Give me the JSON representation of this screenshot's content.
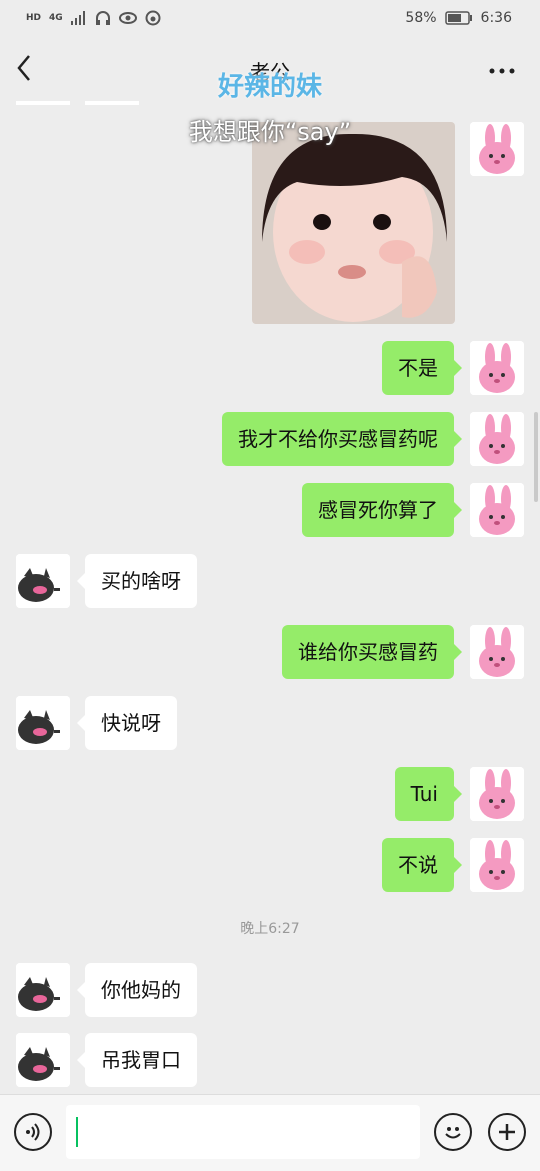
{
  "status_bar": {
    "network": "4G",
    "battery": "58%",
    "time": "6:36"
  },
  "header": {
    "title": "老公"
  },
  "sticker": {
    "caption_top": "好辣的妹",
    "caption_bottom": "我想跟你“say”"
  },
  "messages": [
    {
      "from": "me",
      "text": "不是"
    },
    {
      "from": "me",
      "text": "我才不给你买感冒药呢"
    },
    {
      "from": "me",
      "text": "感冒死你算了"
    },
    {
      "from": "them",
      "text": "买的啥呀"
    },
    {
      "from": "me",
      "text": "谁给你买感冒药"
    },
    {
      "from": "them",
      "text": "快说呀"
    },
    {
      "from": "me",
      "text": "Tui"
    },
    {
      "from": "me",
      "text": "不说"
    },
    {
      "from": "them",
      "text": "你他妈的"
    },
    {
      "from": "them",
      "text": "吊我胃口"
    }
  ],
  "timestamp": "晚上6:27",
  "input_bar": {
    "voice_icon": "voice-icon",
    "emoji_icon": "emoji-icon",
    "plus_icon": "plus-icon"
  }
}
